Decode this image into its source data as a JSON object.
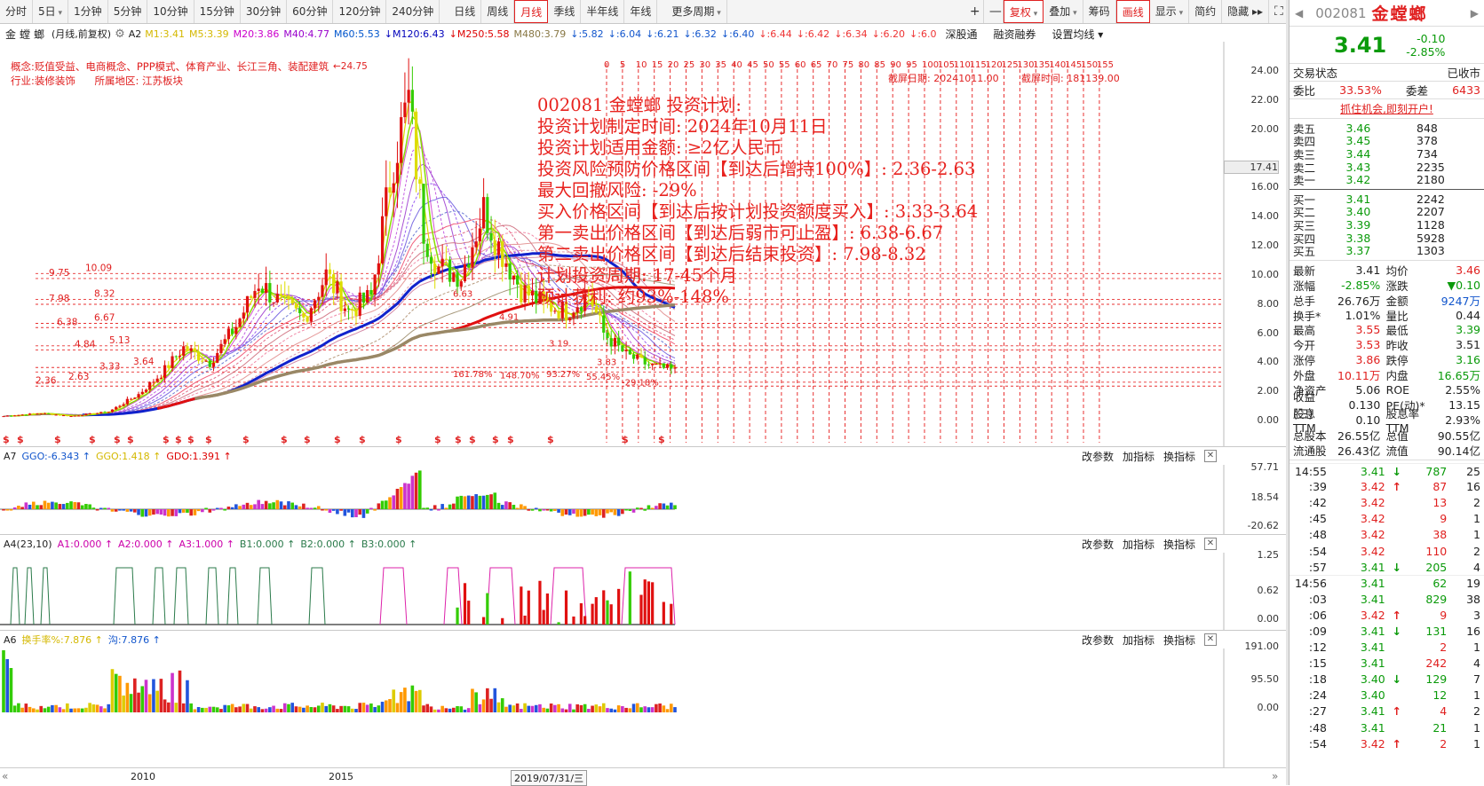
{
  "toolbar": {
    "period_buttons": [
      "分时",
      "5日",
      "1分钟",
      "5分钟",
      "10分钟",
      "15分钟",
      "30分钟",
      "60分钟",
      "120分钟",
      "240分钟",
      "日线",
      "周线",
      "月线",
      "季线",
      "半年线",
      "年线",
      "更多周期"
    ],
    "active_period": "月线",
    "right_buttons": [
      "+",
      "—",
      "复权",
      "叠加",
      "筹码",
      "画线",
      "显示",
      "简约",
      "隐藏"
    ],
    "fq_label": "复权",
    "draw_label": "画线"
  },
  "mainchart": {
    "stock_name": "金螳螂",
    "mode": "(月线,前复权)",
    "indicator": "A2",
    "ma_labels": [
      {
        "text": "M1:3.41",
        "color": "#d4b800"
      },
      {
        "text": "M5:3.39",
        "color": "#d4b800"
      },
      {
        "text": "M20:3.86",
        "color": "#cc00cc"
      },
      {
        "text": "M40:4.77",
        "color": "#9900cc"
      },
      {
        "text": "M60:5.53",
        "color": "#0055cc"
      },
      {
        "text": "M120:6.43",
        "color": "#0000bb"
      },
      {
        "text": "M250:5.58",
        "color": "#dd0000"
      },
      {
        "text": "M480:3.79",
        "color": "#887744"
      },
      {
        "text": ":5.82",
        "color": "#1155cc"
      },
      {
        "text": ":6.04",
        "color": "#1155cc"
      },
      {
        "text": ":6.21",
        "color": "#1155cc"
      },
      {
        "text": ":6.32",
        "color": "#1155cc"
      },
      {
        "text": ":6.40",
        "color": "#1155cc"
      },
      {
        "text": ":6.44",
        "color": "#ee3333"
      },
      {
        "text": ":6.42",
        "color": "#ee3333"
      },
      {
        "text": ":6.34",
        "color": "#ee3333"
      },
      {
        "text": ":6.20",
        "color": "#ee3333"
      },
      {
        "text": ":6.0",
        "color": "#ee3333"
      }
    ],
    "header_buttons": [
      "深股通",
      "融资融券",
      "设置均线"
    ],
    "concept": "概念:贬值受益、电商概念、PPP模式、体育产业、长江三角、装配建筑",
    "industry": "行业:装修装饰",
    "region": "所属地区: 江苏板块",
    "peak_label": "24.75",
    "y_ticks": [
      "24.00",
      "22.00",
      "20.00",
      "17.41",
      "16.00",
      "14.00",
      "12.00",
      "10.00",
      "8.00",
      "6.00",
      "4.00",
      "2.00",
      "0.00"
    ],
    "grid_numbers": [
      "0",
      "5",
      "10",
      "15",
      "20",
      "25",
      "30",
      "35",
      "40",
      "45",
      "50",
      "55",
      "60",
      "65",
      "70",
      "75",
      "80",
      "85",
      "90",
      "95",
      "100",
      "105",
      "110",
      "115",
      "120",
      "125",
      "130",
      "135",
      "140",
      "145",
      "150",
      "155"
    ],
    "screenshot_date": "截屏日期: 20241011.00",
    "screenshot_time": "截屏时间: 181139.00",
    "level_labels": [
      {
        "a": "9.75",
        "b": "10.09"
      },
      {
        "a": "7.98",
        "b": "8.32"
      },
      {
        "a": "6.38",
        "b": "6.67"
      },
      {
        "a": "4.84",
        "b": "5.13"
      },
      {
        "a": "3.33",
        "b": "3.64"
      },
      {
        "a": "2.36",
        "b": "2.63"
      }
    ],
    "inline_labels": [
      "6.63",
      "4.91",
      "3.19",
      "3.83",
      "161.78%",
      "148.70%",
      "93.27%",
      "55.45%",
      "-29.18%"
    ],
    "plan": [
      "002081 金螳螂 投资计划:",
      "投资计划制定时间: 2024年10月11日",
      "投资计划适用金额: ≥2亿人民币",
      "投资风险预防价格区间【到达后增持100%】: 2.36-2.63",
      "最大回撤风险: -29%",
      "买入价格区间【到达后按计划投资额度买入】: 3.33-3.64",
      "第一卖出价格区间【到达后弱市可止盈】: 6.38-6.67",
      "第二卖出价格区间【到达后结束投资】: 7.98-8.32",
      "计划投资周期: 17-45个月",
      "预计获利: 约93%-148%"
    ]
  },
  "sub1": {
    "name": "A7",
    "values": [
      {
        "text": "GGO:-6.343",
        "color": "#1155cc"
      },
      {
        "text": "GGO:1.418",
        "color": "#d4b800"
      },
      {
        "text": "GDO:1.391",
        "color": "#dd0000"
      }
    ],
    "y_ticks": [
      "57.71",
      "18.54",
      "-20.62"
    ]
  },
  "sub2": {
    "name": "A4(23,10)",
    "values": [
      {
        "text": "A1:0.000",
        "color": "#cc00aa"
      },
      {
        "text": "A2:0.000",
        "color": "#cc00aa"
      },
      {
        "text": "A3:1.000",
        "color": "#cc00aa"
      },
      {
        "text": "B1:0.000",
        "color": "#2a7a4a"
      },
      {
        "text": "B2:0.000",
        "color": "#2a7a4a"
      },
      {
        "text": "B3:0.000",
        "color": "#2a7a4a"
      }
    ],
    "y_ticks": [
      "1.25",
      "0.62",
      "0.00"
    ]
  },
  "sub3": {
    "name": "A6",
    "values": [
      {
        "text": "换手率%:7.876",
        "color": "#d4b800"
      },
      {
        "text": "沟:7.876",
        "color": "#1155cc"
      }
    ],
    "y_ticks": [
      "191.00",
      "95.50",
      "0.00"
    ]
  },
  "sub_controls": [
    "改参数",
    "加指标",
    "换指标"
  ],
  "bottom": {
    "year1": "2010",
    "year2": "2015",
    "cursor_date": "2019/07/31/三"
  },
  "quote": {
    "code": "002081",
    "name": "金螳螂",
    "price": "3.41",
    "change": "-0.10",
    "change_pct": "-2.85%",
    "status_label": "交易状态",
    "status_value": "已收市",
    "weibi_label": "委比",
    "weibi_value": "33.53%",
    "weicha_label": "委差",
    "weicha_value": "6433",
    "promo": "抓住机会,即刻开户!",
    "asks": [
      {
        "label": "卖五",
        "price": "3.46",
        "vol": "848"
      },
      {
        "label": "卖四",
        "price": "3.45",
        "vol": "378"
      },
      {
        "label": "卖三",
        "price": "3.44",
        "vol": "734"
      },
      {
        "label": "卖二",
        "price": "3.43",
        "vol": "2235"
      },
      {
        "label": "卖一",
        "price": "3.42",
        "vol": "2180"
      }
    ],
    "bids": [
      {
        "label": "买一",
        "price": "3.41",
        "vol": "2242"
      },
      {
        "label": "买二",
        "price": "3.40",
        "vol": "2207"
      },
      {
        "label": "买三",
        "price": "3.39",
        "vol": "1128"
      },
      {
        "label": "买四",
        "price": "3.38",
        "vol": "5928"
      },
      {
        "label": "买五",
        "price": "3.37",
        "vol": "1303"
      }
    ],
    "stats": [
      {
        "l1": "最新",
        "v1": "3.41",
        "c1": "bk",
        "l2": "均价",
        "v2": "3.46",
        "c2": "red"
      },
      {
        "l1": "涨幅",
        "v1": "-2.85%",
        "c1": "green",
        "l2": "涨跌",
        "v2": "▼0.10",
        "c2": "green"
      },
      {
        "l1": "总手",
        "v1": "26.76万",
        "c1": "bk",
        "l2": "金额",
        "v2": "9247万",
        "c2": "blue"
      },
      {
        "l1": "换手*",
        "v1": "1.01%",
        "c1": "bk",
        "l2": "量比",
        "v2": "0.44",
        "c2": "bk"
      },
      {
        "l1": "最高",
        "v1": "3.55",
        "c1": "red",
        "l2": "最低",
        "v2": "3.39",
        "c2": "green"
      },
      {
        "l1": "今开",
        "v1": "3.53",
        "c1": "red",
        "l2": "昨收",
        "v2": "3.51",
        "c2": "bk"
      },
      {
        "l1": "涨停",
        "v1": "3.86",
        "c1": "red",
        "l2": "跌停",
        "v2": "3.16",
        "c2": "green"
      },
      {
        "l1": "外盘",
        "v1": "10.11万",
        "c1": "red",
        "l2": "内盘",
        "v2": "16.65万",
        "c2": "green"
      },
      {
        "l1": "净资产",
        "v1": "5.06",
        "c1": "bk",
        "l2": "ROE",
        "v2": "2.55%",
        "c2": "bk"
      },
      {
        "l1": "收益(三)",
        "v1": "0.130",
        "c1": "bk",
        "l2": "PE(动)*",
        "v2": "13.15",
        "c2": "bk"
      },
      {
        "l1": "股息TTM",
        "v1": "0.10",
        "c1": "bk",
        "l2": "股息率TTM",
        "v2": "2.93%",
        "c2": "bk"
      },
      {
        "l1": "总股本",
        "v1": "26.55亿",
        "c1": "bk",
        "l2": "总值",
        "v2": "90.55亿",
        "c2": "bk"
      },
      {
        "l1": "流通股",
        "v1": "26.43亿",
        "c1": "bk",
        "l2": "流值",
        "v2": "90.14亿",
        "c2": "bk"
      }
    ],
    "ticks": [
      {
        "t": "14:55",
        "p": "3.41",
        "arrow": "down",
        "v": "787",
        "vc": "green",
        "n": "25"
      },
      {
        "t": ":39",
        "p": "3.42",
        "arrow": "up",
        "v": "87",
        "vc": "red",
        "n": "16"
      },
      {
        "t": ":42",
        "p": "3.42",
        "arrow": "",
        "v": "13",
        "vc": "red",
        "n": "2"
      },
      {
        "t": ":45",
        "p": "3.42",
        "arrow": "",
        "v": "9",
        "vc": "red",
        "n": "1"
      },
      {
        "t": ":48",
        "p": "3.42",
        "arrow": "",
        "v": "38",
        "vc": "red",
        "n": "1"
      },
      {
        "t": ":54",
        "p": "3.42",
        "arrow": "",
        "v": "110",
        "vc": "red",
        "n": "2"
      },
      {
        "t": ":57",
        "p": "3.41",
        "arrow": "down",
        "v": "205",
        "vc": "green",
        "n": "4"
      },
      {
        "t": "14:56",
        "p": "3.41",
        "arrow": "",
        "v": "62",
        "vc": "green",
        "n": "19"
      },
      {
        "t": ":03",
        "p": "3.41",
        "arrow": "",
        "v": "829",
        "vc": "green",
        "n": "38"
      },
      {
        "t": ":06",
        "p": "3.42",
        "arrow": "up",
        "v": "9",
        "vc": "red",
        "n": "3"
      },
      {
        "t": ":09",
        "p": "3.41",
        "arrow": "down",
        "v": "131",
        "vc": "green",
        "n": "16"
      },
      {
        "t": ":12",
        "p": "3.41",
        "arrow": "",
        "v": "2",
        "vc": "red",
        "n": "1"
      },
      {
        "t": ":15",
        "p": "3.41",
        "arrow": "",
        "v": "242",
        "vc": "red",
        "n": "4"
      },
      {
        "t": ":18",
        "p": "3.40",
        "arrow": "down",
        "v": "129",
        "vc": "green",
        "n": "7"
      },
      {
        "t": ":24",
        "p": "3.40",
        "arrow": "",
        "v": "12",
        "vc": "green",
        "n": "1"
      },
      {
        "t": ":27",
        "p": "3.41",
        "arrow": "up",
        "v": "4",
        "vc": "red",
        "n": "2"
      },
      {
        "t": ":48",
        "p": "3.41",
        "arrow": "",
        "v": "21",
        "vc": "green",
        "n": "1"
      },
      {
        "t": ":54",
        "p": "3.42",
        "arrow": "up",
        "v": "2",
        "vc": "red",
        "n": "1"
      }
    ]
  }
}
